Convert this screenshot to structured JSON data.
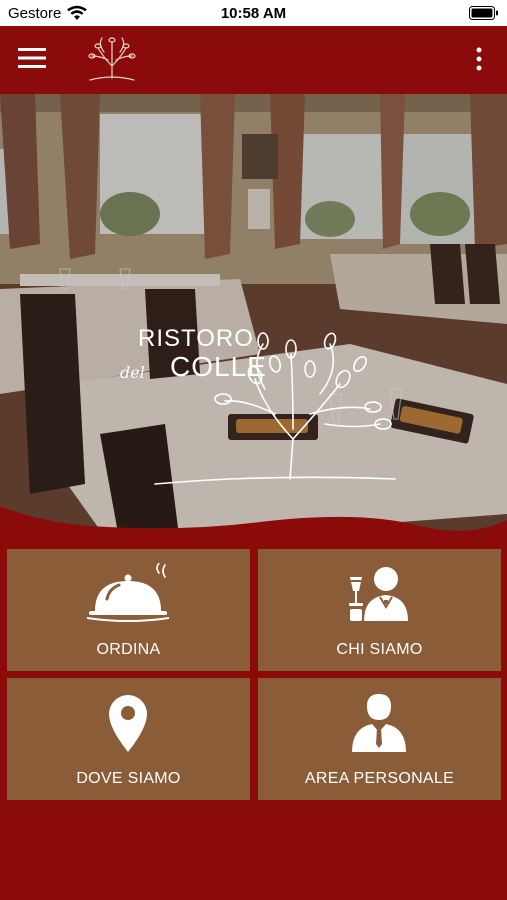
{
  "status_bar": {
    "carrier": "Gestore",
    "time": "10:58 AM"
  },
  "app_bar": {
    "menu_icon": "hamburger-menu-icon",
    "logo_icon": "tree-logo-icon",
    "more_icon": "vertical-dots-icon"
  },
  "hero": {
    "brand": {
      "line1": "RISTORO",
      "line2": "del",
      "line3": "COLLE"
    }
  },
  "tiles": [
    {
      "label": "ORDINA",
      "icon": "cloche-icon"
    },
    {
      "label": "CHI SIAMO",
      "icon": "waiter-icon"
    },
    {
      "label": "DOVE SIAMO",
      "icon": "location-pin-icon"
    },
    {
      "label": "AREA PERSONALE",
      "icon": "person-icon"
    }
  ],
  "colors": {
    "primary": "#8b0a0a",
    "tile": "#8a5c38",
    "text": "#ffffff"
  }
}
